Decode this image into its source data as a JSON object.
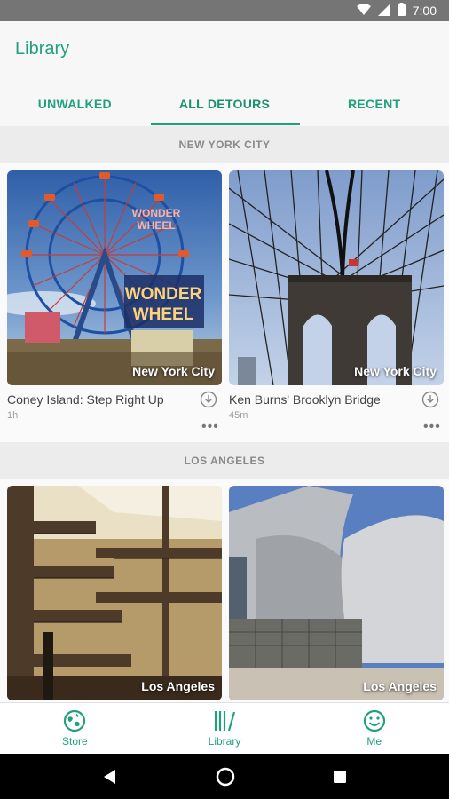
{
  "status_bar": {
    "time": "7:00"
  },
  "app": {
    "title": "Library"
  },
  "tabs": [
    {
      "label": "UNWALKED"
    },
    {
      "label": "ALL DETOURS"
    },
    {
      "label": "RECENT"
    }
  ],
  "sections": [
    {
      "header": "NEW YORK CITY",
      "cards": [
        {
          "title": "Coney Island: Step Right Up",
          "duration": "1h",
          "city": "New York City"
        },
        {
          "title": "Ken Burns' Brooklyn Bridge",
          "duration": "45m",
          "city": "New York City"
        }
      ]
    },
    {
      "header": "LOS ANGELES",
      "cards": [
        {
          "city": "Los Angeles"
        },
        {
          "city": "Los Angeles"
        }
      ]
    }
  ],
  "bottom_nav": [
    {
      "label": "Store",
      "icon": "globe-icon"
    },
    {
      "label": "Library",
      "icon": "library-icon"
    },
    {
      "label": "Me",
      "icon": "smiley-icon"
    }
  ],
  "colors": {
    "accent": "#21a07e",
    "status_bar": "#757575"
  }
}
